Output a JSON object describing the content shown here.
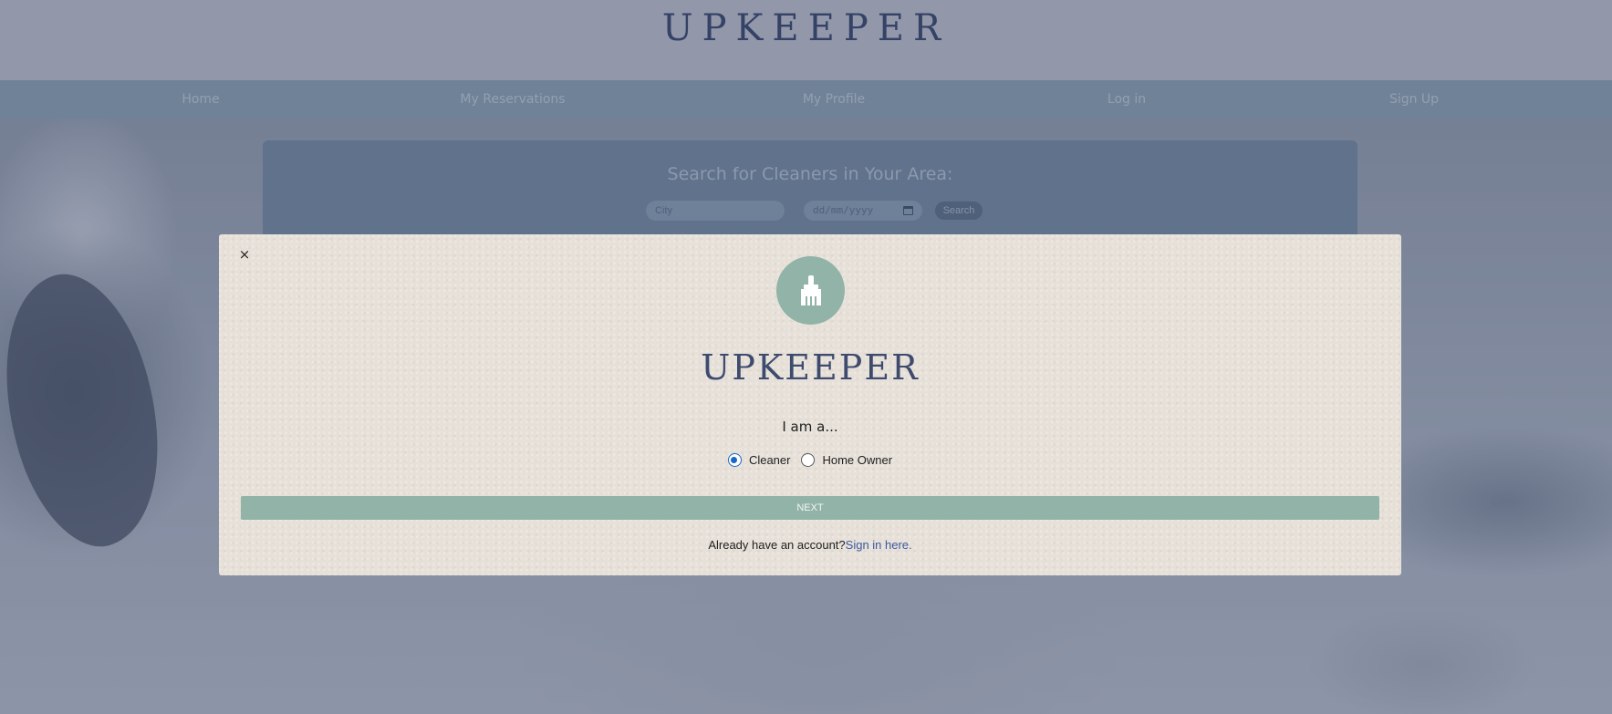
{
  "header": {
    "brand": "UPKEEPER"
  },
  "nav": {
    "items": [
      {
        "label": "Home"
      },
      {
        "label": "My Reservations"
      },
      {
        "label": "My Profile"
      },
      {
        "label": "Log in"
      },
      {
        "label": "Sign Up"
      }
    ]
  },
  "search": {
    "title": "Search for Cleaners in Your Area:",
    "city_placeholder": "City",
    "date_placeholder": "dd/mm/yyyy",
    "button_label": "Search"
  },
  "modal": {
    "close_label": "×",
    "icon": "broom-icon",
    "brand": "UPKEEPER",
    "prompt": "I am a...",
    "options": [
      {
        "label": "Cleaner",
        "checked": true
      },
      {
        "label": "Home Owner",
        "checked": false
      }
    ],
    "next_label": "NEXT",
    "account_text": "Already have an account?",
    "signin_link": "Sign in here."
  },
  "colors": {
    "brand_navy": "#3e4b6e",
    "sage_accent": "#92b3a8",
    "radio_blue": "#1a66c4",
    "link_blue": "#3d5aa0"
  }
}
